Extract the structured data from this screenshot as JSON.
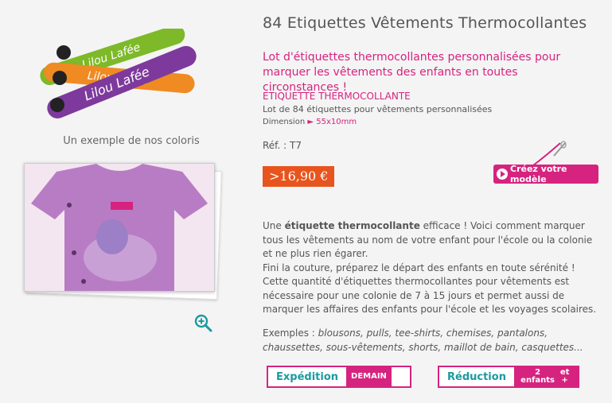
{
  "left": {
    "caption": "Un exemple de nos coloris",
    "label_text": "Lilou Lafée",
    "label_colors": [
      "#7db928",
      "#f08a22",
      "#7d3a9c"
    ]
  },
  "product": {
    "title": "84 Etiquettes Vêtements Thermocollantes",
    "intro": "Lot d'étiquettes thermocollantes personnalisées pour marquer les vêtements des enfants en toutes circonstances !",
    "subtitle": "ETIQUETTE THERMOCOLLANTE",
    "subdesc": "Lot de 84 étiquettes pour vêtements personnalisées",
    "dimension_label": "Dimension",
    "dimension_value": "► 55x10mm",
    "ref": "Réf. : T7",
    "price": ">16,90 €",
    "create_button": "Créez votre modèle"
  },
  "description": {
    "p1_a": "Une ",
    "p1_bold": "étiquette thermocollante",
    "p1_b": " efficace ! Voici comment marquer tous les vêtements au nom de votre enfant pour l'école ou la colonie et ne plus rien égarer.",
    "p2": "Fini la couture, préparez le départ des enfants en toute sérénité ! Cette quantité d'étiquettes thermocollantes pour vêtements est nécessaire pour une colonie de 7 à 15 jours et permet aussi de marquer les affaires des enfants pour l'école et les voyages scolaires.",
    "examples_label": "Exemples : ",
    "examples_list": "blousons, pulls, tee-shirts, chemises, pantalons, chaussettes, sous-vêtements, shorts, maillot de bain, casquettes..."
  },
  "badges": {
    "expedition": "Expédition",
    "expedition_right": "DEMAIN",
    "reduction": "Réduction",
    "reduction_right_1": "2 enfants",
    "reduction_right_2": "et +"
  },
  "colors": {
    "accent": "#d6237f",
    "price": "#e8541d",
    "teal": "#1a9aa0"
  }
}
